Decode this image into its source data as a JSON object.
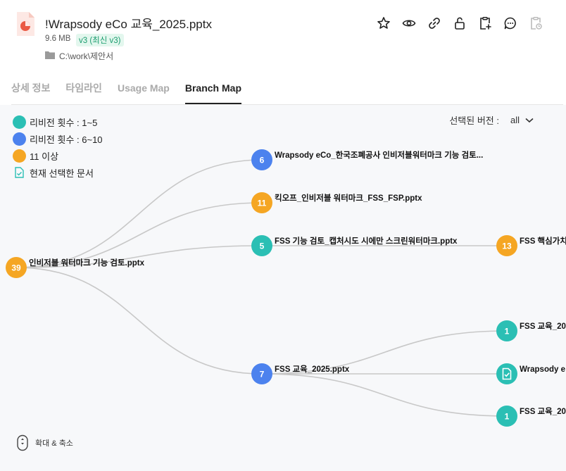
{
  "file": {
    "title": "!Wrapsody eCo 교육_2025.pptx",
    "size": "9.6 MB",
    "version": "v3 (최신 v3)",
    "path": "C:\\work\\제안서"
  },
  "toolbar": [
    {
      "name": "star-icon"
    },
    {
      "name": "eye-icon"
    },
    {
      "name": "link-icon"
    },
    {
      "name": "unlock-icon"
    },
    {
      "name": "clipboard-add-icon"
    },
    {
      "name": "chat-icon"
    },
    {
      "name": "clipboard-history-icon"
    }
  ],
  "tabs": [
    "상세 정보",
    "타임라인",
    "Usage Map",
    "Branch Map"
  ],
  "active_tab": "Branch Map",
  "legend": {
    "teal": "리비전 횟수 : 1~5",
    "blue": "리비전 횟수 : 6~10",
    "orange": "11 이상",
    "current": "현재 선택한 문서"
  },
  "colors": {
    "teal": "#2bbfb4",
    "blue": "#4c82ee",
    "orange": "#f5a623",
    "edge": "#c8c8c8"
  },
  "version_select": {
    "label": "선택된 버전 :",
    "value": "all"
  },
  "zoom_label": "확대 & 축소",
  "nodes": [
    {
      "id": "root",
      "num": "39",
      "color": "orange",
      "label": "인비저블 워터마크 기능 검토.pptx"
    },
    {
      "id": "n1",
      "num": "6",
      "color": "blue",
      "label": "Wrapsody eCo_한국조폐공사 인비저블워터마크 기능 검토..."
    },
    {
      "id": "n2",
      "num": "11",
      "color": "orange",
      "label": "킥오프_인비저블 워터마크_FSS_FSP.pptx"
    },
    {
      "id": "n3",
      "num": "5",
      "color": "teal",
      "label": "FSS 기능 검토_캡처시도 시에만 스크린워터마크.pptx"
    },
    {
      "id": "n4",
      "num": "13",
      "color": "orange",
      "label": "FSS 핵심가치"
    },
    {
      "id": "n5",
      "num": "7",
      "color": "blue",
      "label": "FSS 교육_2025.pptx"
    },
    {
      "id": "n6",
      "num": "1",
      "color": "teal",
      "label": "FSS 교육_20"
    },
    {
      "id": "n7",
      "num": "",
      "color": "teal",
      "label": "Wrapsody e",
      "current": true
    },
    {
      "id": "n8",
      "num": "1",
      "color": "teal",
      "label": "FSS 교육_20"
    }
  ]
}
